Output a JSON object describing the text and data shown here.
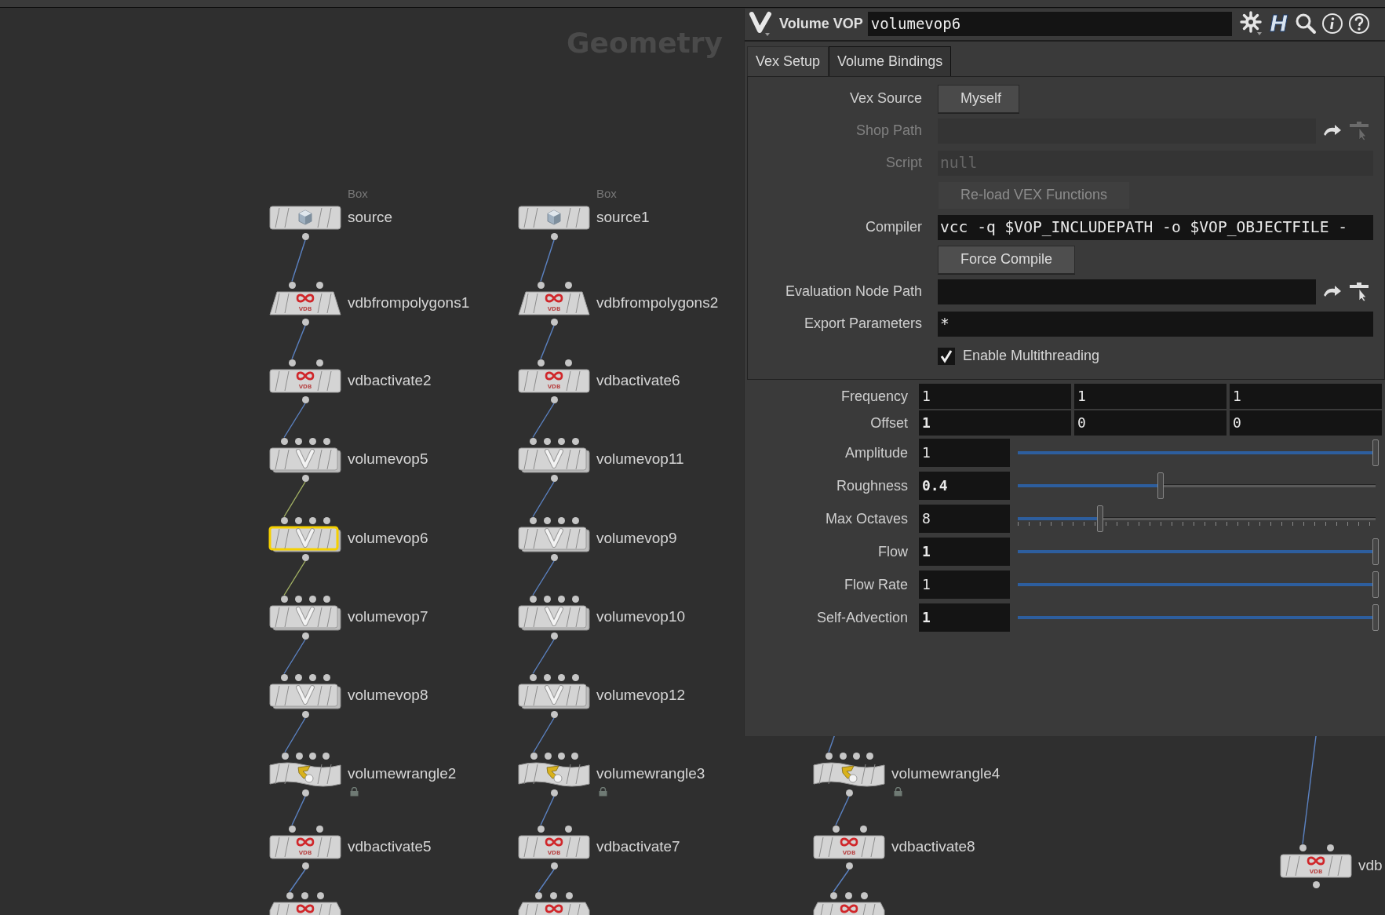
{
  "network": {
    "title": "Geometry",
    "chains": [
      {
        "nodes": [
          {
            "kind": "box",
            "type_label": "Box",
            "label": "source",
            "selected": false
          },
          {
            "kind": "vdbfrompolygons",
            "badge": "VDB",
            "label": "vdbfrompolygons1",
            "selected": false
          },
          {
            "kind": "vdbactivate",
            "badge": "VDB",
            "label": "vdbactivate2",
            "selected": false
          },
          {
            "kind": "volumevop",
            "label": "volumevop5",
            "selected": false
          },
          {
            "kind": "volumevop",
            "label": "volumevop6",
            "selected": true
          },
          {
            "kind": "volumevop",
            "label": "volumevop7",
            "selected": false
          },
          {
            "kind": "volumevop",
            "label": "volumevop8",
            "selected": false
          },
          {
            "kind": "volumewrangle",
            "label": "volumewrangle2",
            "selected": false,
            "locked": true
          },
          {
            "kind": "vdbactivate",
            "badge": "VDB",
            "label": "vdbactivate5",
            "selected": false
          },
          {
            "kind": "convertvdb",
            "selected": false
          }
        ]
      },
      {
        "nodes": [
          {
            "kind": "box",
            "type_label": "Box",
            "label": "source1",
            "selected": false
          },
          {
            "kind": "vdbfrompolygons",
            "badge": "VDB",
            "label": "vdbfrompolygons2",
            "selected": false
          },
          {
            "kind": "vdbactivate",
            "badge": "VDB",
            "label": "vdbactivate6",
            "selected": false
          },
          {
            "kind": "volumevop",
            "label": "volumevop11",
            "selected": false
          },
          {
            "kind": "volumevop",
            "label": "volumevop9",
            "selected": false
          },
          {
            "kind": "volumevop",
            "label": "volumevop10",
            "selected": false
          },
          {
            "kind": "volumevop",
            "label": "volumevop12",
            "selected": false
          },
          {
            "kind": "volumewrangle",
            "label": "volumewrangle3",
            "selected": false,
            "locked": true
          },
          {
            "kind": "vdbactivate",
            "badge": "VDB",
            "label": "vdbactivate7",
            "selected": false
          },
          {
            "kind": "convertvdb",
            "selected": false
          }
        ]
      },
      {
        "nodes": [
          {
            "kind": "volumewrangle",
            "label": "volumewrangle4",
            "selected": false,
            "locked": true
          },
          {
            "kind": "vdbactivate",
            "badge": "VDB",
            "label": "vdbactivate8",
            "selected": false
          },
          {
            "kind": "convertvdb",
            "selected": false
          }
        ]
      },
      {
        "nodes": [
          {
            "kind": "vdbactivate",
            "badge": "VDB",
            "label": "vdb",
            "selected": false
          }
        ]
      }
    ]
  },
  "parameters": {
    "node_type": "Volume VOP",
    "node_name": "volumevop6",
    "toolbar_letter": "H",
    "tabs": [
      {
        "label": "Vex Setup",
        "selected": true
      },
      {
        "label": "Volume Bindings",
        "selected": false
      }
    ],
    "tab_rows": [
      {
        "kind": "menu",
        "label": "Vex Source",
        "value": "Myself",
        "disabled": false
      },
      {
        "kind": "path",
        "label": "Shop Path",
        "disabled": true
      },
      {
        "kind": "text",
        "label": "Script",
        "value": "null",
        "disabled": true
      },
      {
        "kind": "button",
        "label": "Re-load VEX Functions",
        "disabled": true
      },
      {
        "kind": "text",
        "label": "Compiler",
        "value": "vcc -q $VOP_INCLUDEPATH -o $VOP_OBJECTFILE -",
        "disabled": false
      },
      {
        "kind": "button",
        "label": "Force Compile",
        "disabled": false
      },
      {
        "kind": "path",
        "label": "Evaluation Node Path",
        "disabled": false
      },
      {
        "kind": "text",
        "label": "Export Parameters",
        "value": "*",
        "disabled": false
      },
      {
        "kind": "checkbox",
        "label": "Enable Multithreading",
        "checked": true,
        "disabled": false
      }
    ],
    "params": [
      {
        "kind": "vector",
        "label": "Frequency",
        "values": [
          {
            "text": "1",
            "modified": false
          },
          {
            "text": "1",
            "modified": false
          },
          {
            "text": "1",
            "modified": false
          }
        ]
      },
      {
        "kind": "vector",
        "label": "Offset",
        "values": [
          {
            "text": "1",
            "modified": true
          },
          {
            "text": "0",
            "modified": false
          },
          {
            "text": "0",
            "modified": false
          }
        ]
      },
      {
        "kind": "float_slider",
        "label": "Amplitude",
        "value": "1",
        "modified": false,
        "level": 1
      },
      {
        "kind": "float_slider",
        "label": "Roughness",
        "value": "0.4",
        "modified": true,
        "level": 0.4
      },
      {
        "kind": "int_slider",
        "label": "Max Octaves",
        "value": "8",
        "modified": false,
        "level": 0.23
      },
      {
        "kind": "float_slider",
        "label": "Flow",
        "value": "1",
        "modified": true,
        "level": 1
      },
      {
        "kind": "float_slider",
        "label": "Flow Rate",
        "value": "1",
        "modified": false,
        "level": 1
      },
      {
        "kind": "float_slider",
        "label": "Self-Advection",
        "value": "1",
        "modified": true,
        "level": 1
      }
    ]
  }
}
